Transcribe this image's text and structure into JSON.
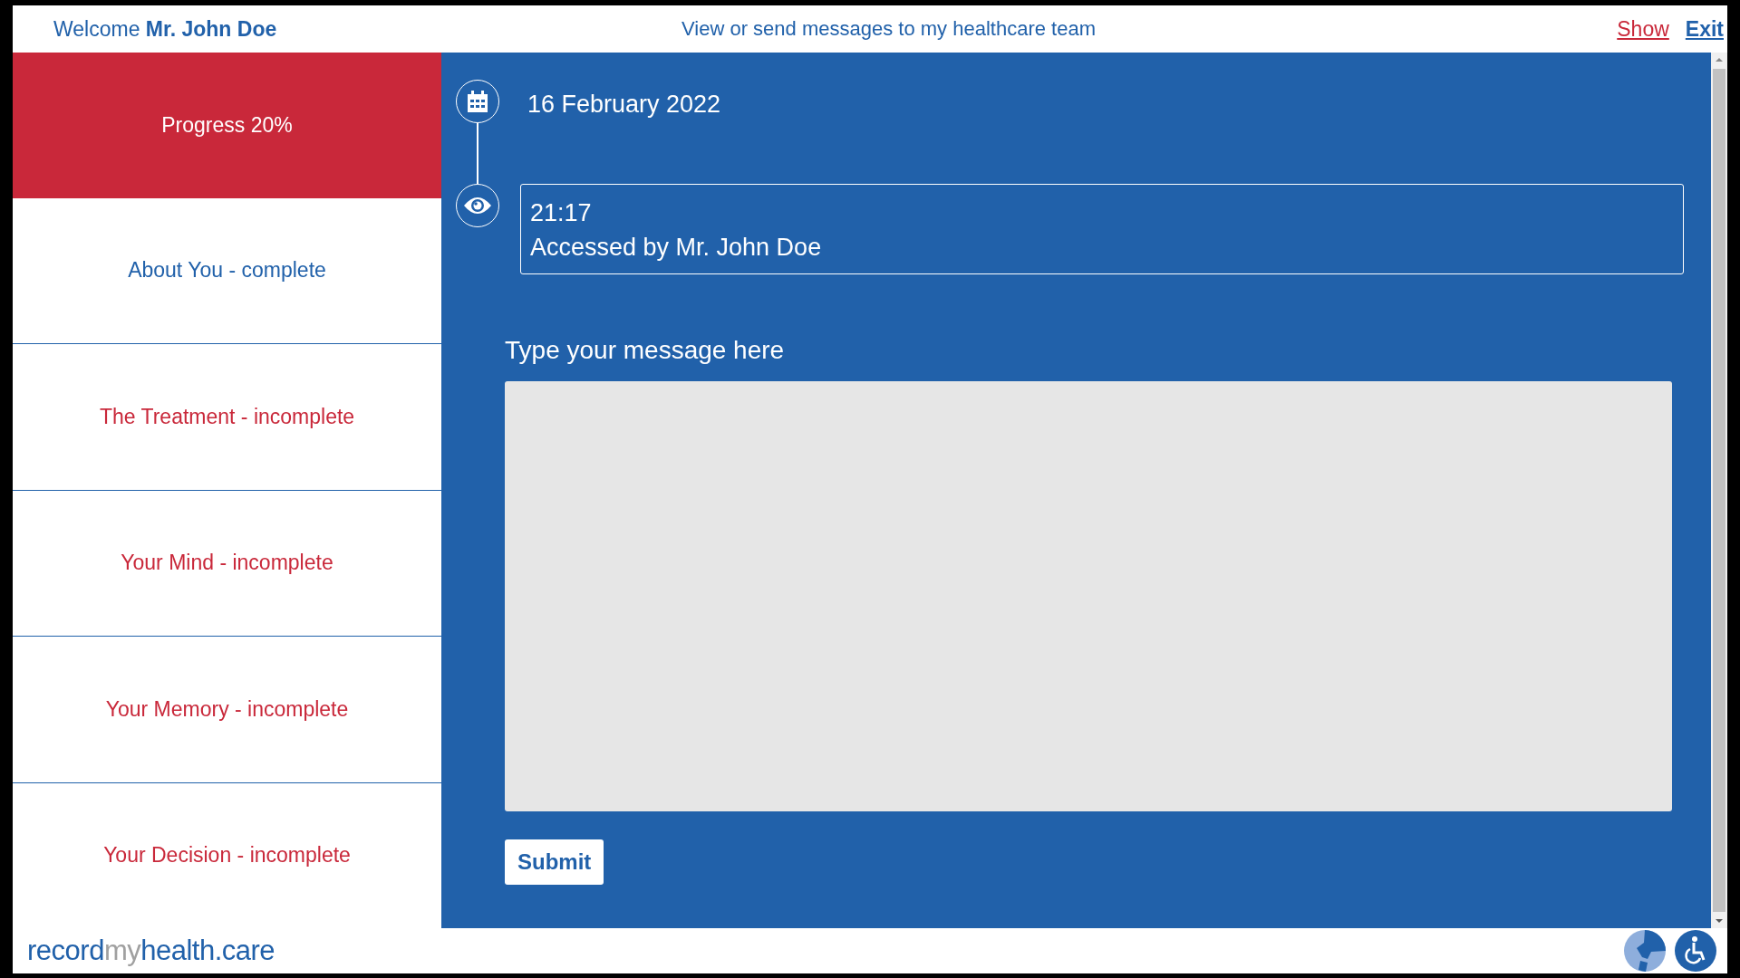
{
  "header": {
    "welcome": "Welcome",
    "user_name": "Mr. John Doe",
    "subtitle": "View or send messages to my healthcare team",
    "links": [
      {
        "label": "Show",
        "color": "#c9283a"
      },
      {
        "label": "Exit",
        "color": "#2161aa"
      }
    ]
  },
  "sidebar": {
    "items": [
      {
        "label": "Progress 20%",
        "kind": "progress"
      },
      {
        "label": "About You - complete",
        "kind": "section",
        "complete": true
      },
      {
        "label": "The Treatment - incomplete",
        "kind": "section",
        "complete": false
      },
      {
        "label": "Your Mind - incomplete",
        "kind": "section",
        "complete": false
      },
      {
        "label": "Your Memory - incomplete",
        "kind": "section",
        "complete": false
      },
      {
        "label": "Your Decision - incomplete",
        "kind": "section",
        "complete": false
      }
    ]
  },
  "timeline": [
    {
      "kind": "date",
      "text": "16 February 2022"
    },
    {
      "kind": "access",
      "time": "21:17",
      "text": "Accessed by Mr. John Doe"
    }
  ],
  "message": {
    "label": "Type your message here",
    "submit": "Submit"
  },
  "footer": {
    "logo": [
      {
        "text": "record",
        "kind": "main"
      },
      {
        "text": "my",
        "kind": "muted"
      },
      {
        "text": "health.care",
        "kind": "main"
      }
    ]
  }
}
